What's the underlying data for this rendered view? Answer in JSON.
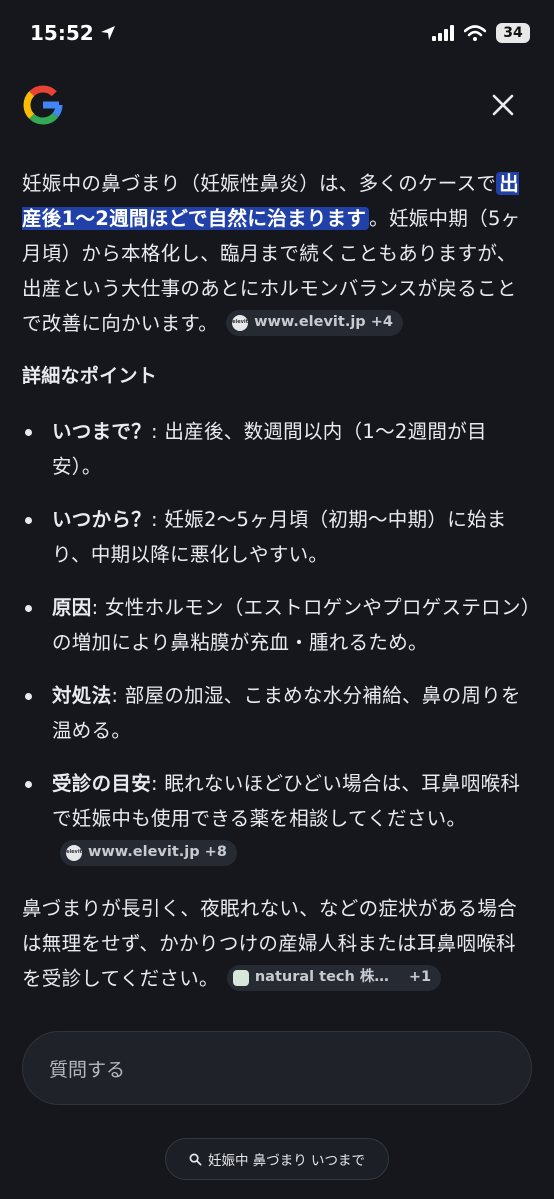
{
  "status_bar": {
    "time": "15:52",
    "battery": "34"
  },
  "answer": {
    "intro_prefix": "妊娠中の鼻づまり（妊娠性鼻炎）は、多くのケースで",
    "intro_highlight": "出産後1〜2週間ほどで自然に治まります",
    "intro_suffix": "。妊娠中期（5ヶ月頃）から本格化し、臨月まで続くこともありますが、出産という大仕事のあとにホルモンバランスが戻ることで改善に向かいます。",
    "intro_source": "www.elevit.jp +4",
    "section_title": "詳細なポイント",
    "points": [
      {
        "title": "いつまで？",
        "text": ": 出産後、数週間以内（1〜2週間が目安）。"
      },
      {
        "title": "いつから？",
        "text": ": 妊娠2〜5ヶ月頃（初期〜中期）に始まり、中期以降に悪化しやすい。"
      },
      {
        "title": "原因",
        "text": ": 女性ホルモン（エストロゲンやプロゲステロン）の増加により鼻粘膜が充血・腫れるため。"
      },
      {
        "title": "対処法",
        "text": ": 部屋の加湿、こまめな水分補給、鼻の周りを温める。"
      },
      {
        "title": "受診の目安",
        "text": ": 眠れないほどひどい場合は、耳鼻咽喉科で妊娠中も使用できる薬を相談してください。",
        "source": "www.elevit.jp +8"
      }
    ],
    "closing": "鼻づまりが長引く、夜眠れない、などの症状がある場合は無理をせず、かかりつけの産婦人科または耳鼻咽喉科を受診してください。",
    "closing_source": "natural tech 株…",
    "closing_source_extra": "+1"
  },
  "ask_placeholder": "質問する",
  "query_pill": "妊娠中 鼻づまり いつまで",
  "colors": {
    "background": "#15171d",
    "highlight": "#2241a8",
    "chip": "#262a33"
  }
}
